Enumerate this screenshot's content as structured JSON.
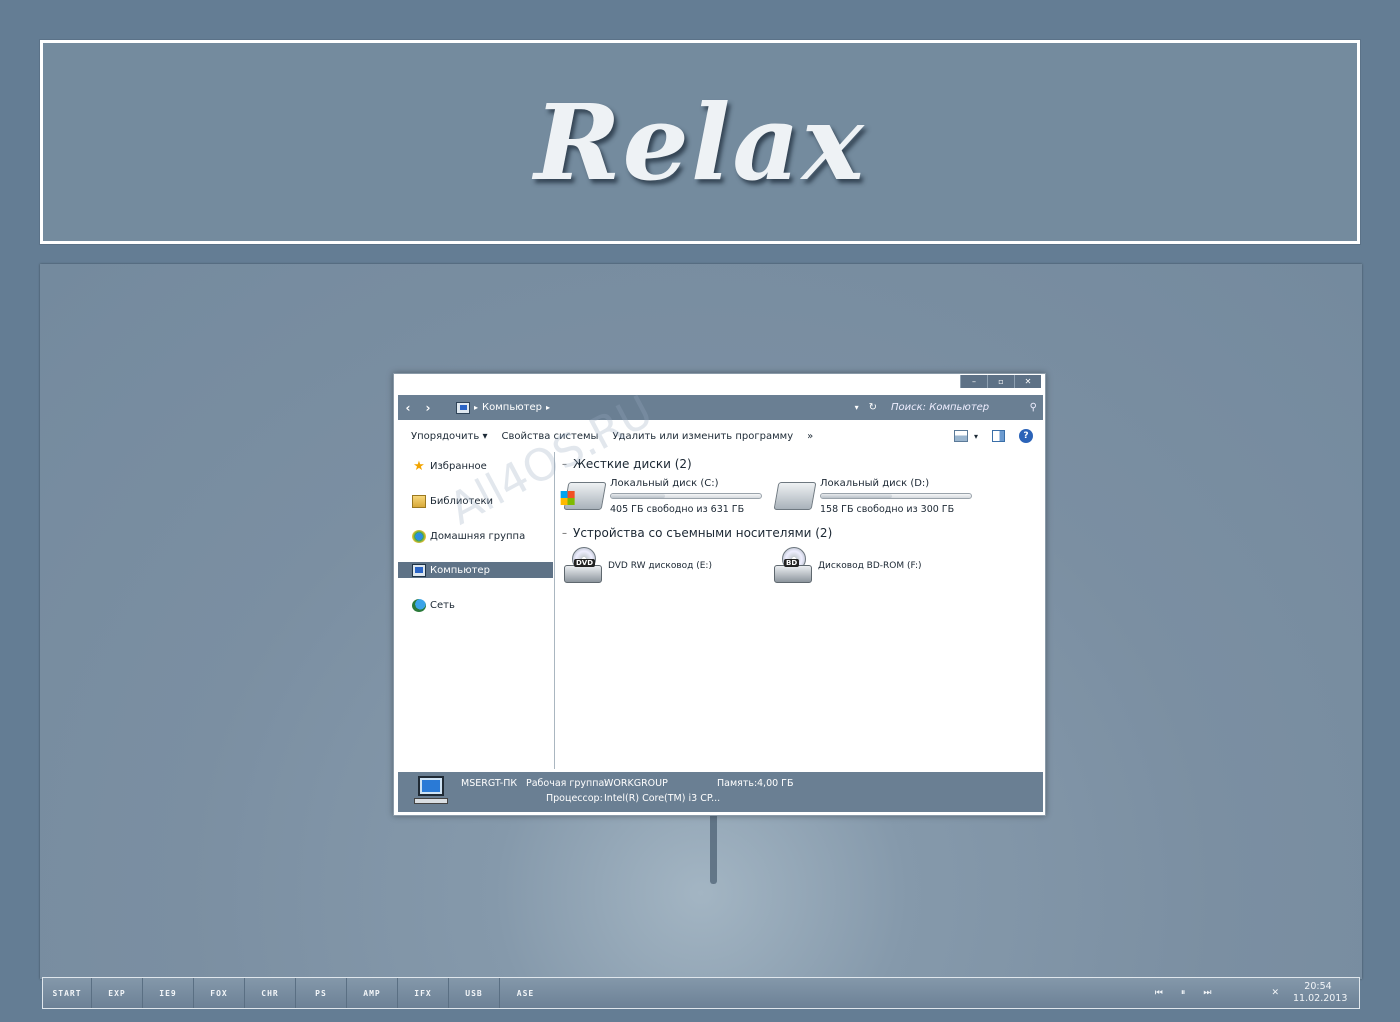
{
  "banner": {
    "title": "Relax"
  },
  "watermark": "All4OS.RU",
  "window": {
    "caption_buttons": {
      "minimize": "–",
      "maximize": "▫",
      "close": "✕"
    },
    "address": {
      "back": "‹",
      "forward": "›",
      "path": "Компьютер",
      "search_placeholder": "Поиск: Компьютер"
    },
    "toolbar": {
      "organize": "Упорядочить",
      "system_properties": "Свойства системы",
      "uninstall": "Удалить или изменить программу",
      "more": "»"
    },
    "nav": {
      "items": [
        {
          "label": "Избранное"
        },
        {
          "label": "Библиотеки"
        },
        {
          "label": "Домашняя группа"
        },
        {
          "label": "Компьютер"
        },
        {
          "label": "Сеть"
        }
      ]
    },
    "groups": {
      "hard_disks": {
        "title": "Жесткие диски (2)",
        "drives": [
          {
            "name": "Локальный диск (C:)",
            "free": "405 ГБ свободно из 631 ГБ",
            "used_fraction": 0.36
          },
          {
            "name": "Локальный диск (D:)",
            "free": "158 ГБ свободно из 300 ГБ",
            "used_fraction": 0.47
          }
        ]
      },
      "removable": {
        "title": "Устройства со съемными носителями (2)",
        "drives": [
          {
            "name": "DVD RW дисковод (E:)",
            "badge": "DVD"
          },
          {
            "name": "Дисковод BD-ROM (F:)",
            "badge": "BD"
          }
        ]
      }
    },
    "details": {
      "computer_name": "MSERGT-ПК",
      "workgroup_label": "Рабочая группа:",
      "workgroup": "WORKGROUP",
      "memory_label": "Память:",
      "memory": "4,00 ГБ",
      "cpu_label": "Процессор:",
      "cpu": "Intel(R) Core(TM) i3 CP..."
    }
  },
  "taskbar": {
    "buttons": [
      "START",
      "EXP",
      "IE9",
      "FOX",
      "CHR",
      "PS",
      "AMP",
      "IFX",
      "USB",
      "ASE"
    ],
    "media": {
      "prev": "⏮",
      "pause": "⏸",
      "next": "⏭"
    },
    "tray_close": "✕",
    "time": "20:54",
    "date": "11.02.2013"
  }
}
